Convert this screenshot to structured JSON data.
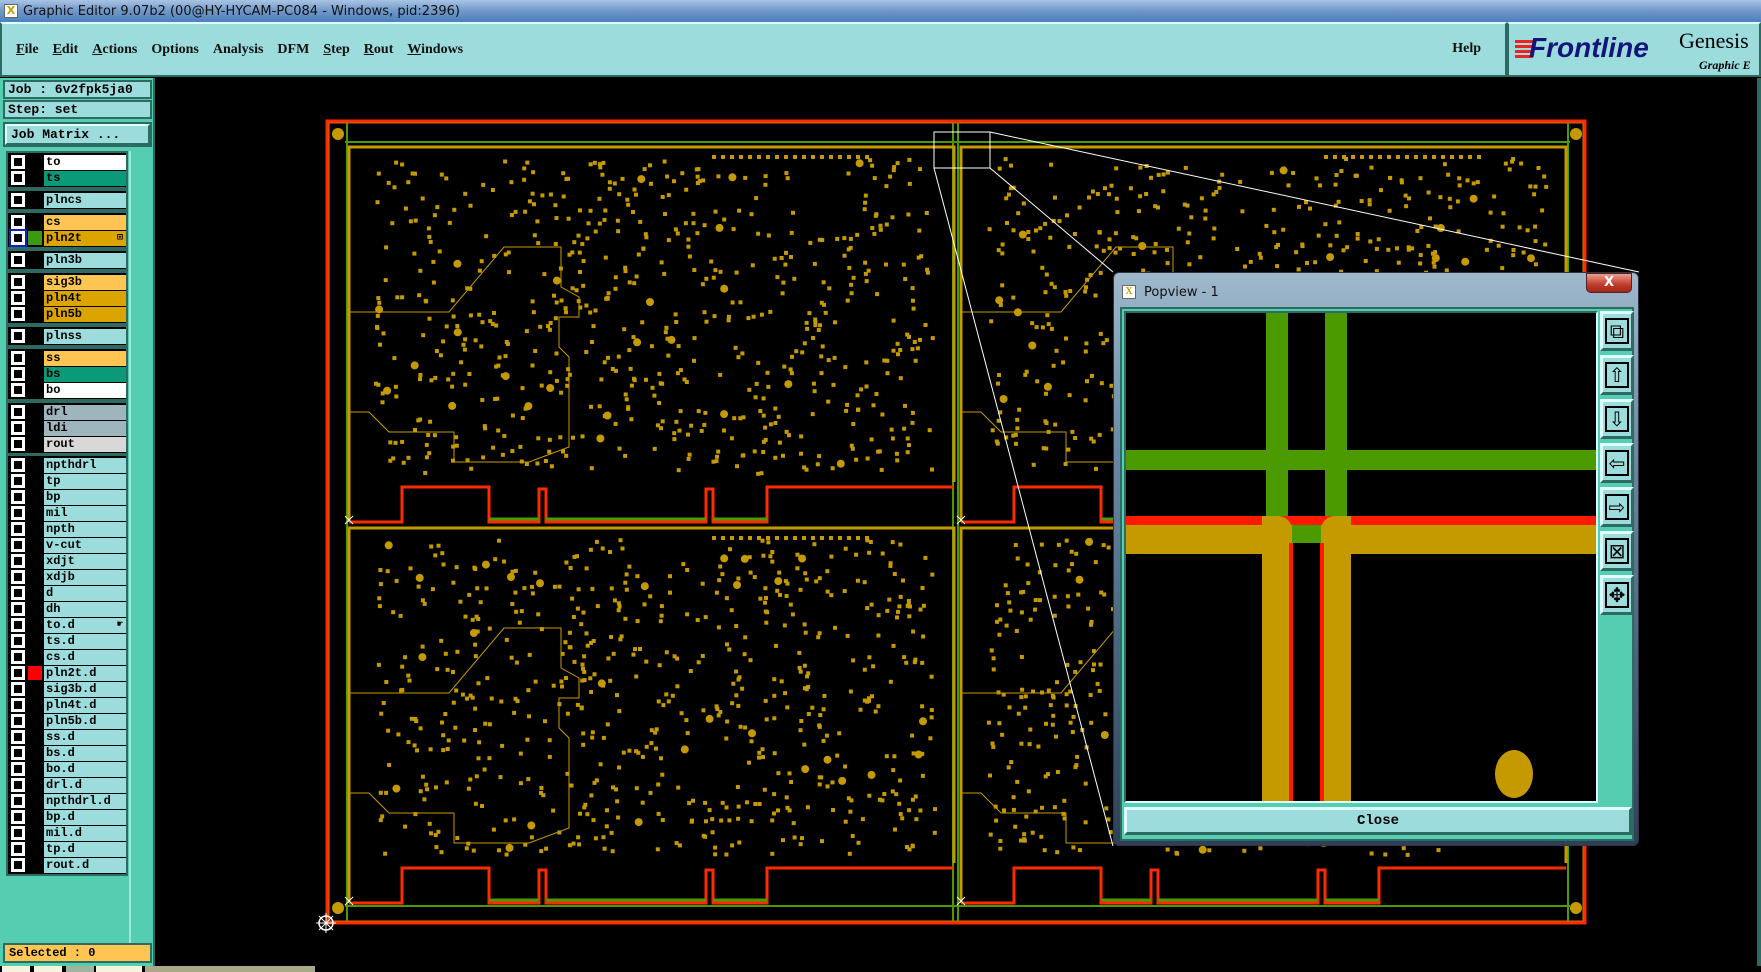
{
  "window": {
    "title": "Graphic Editor 9.07b2 (00@HY-HYCAM-PC084 - Windows, pid:2396)"
  },
  "menu": {
    "items": [
      "File",
      "Edit",
      "Actions",
      "Options",
      "Analysis",
      "DFM",
      "Step",
      "Rout",
      "Windows"
    ],
    "help": "Help"
  },
  "logo": {
    "brand": "Frontline",
    "product": "Genesis",
    "subtitle": "Graphic E"
  },
  "job": {
    "job_label": "Job : 6v2fpk5ja0",
    "step_label": "Step: set",
    "job_matrix_button": "Job Matrix ..."
  },
  "layers": {
    "groups": [
      [
        {
          "name": "to",
          "color": "#ffffff"
        },
        {
          "name": "ts",
          "color": "#0a9a78"
        }
      ],
      [
        {
          "name": "plncs",
          "color": "#9ddcdc"
        }
      ],
      [
        {
          "name": "cs",
          "color": "#ffc552"
        },
        {
          "name": "pln2t",
          "color": "#dca400",
          "swatch": "#3c9a10",
          "active": true,
          "marker": "⊞"
        }
      ],
      [
        {
          "name": "pln3b",
          "color": "#9ddcdc"
        }
      ],
      [
        {
          "name": "sig3b",
          "color": "#ffc552"
        },
        {
          "name": "pln4t",
          "color": "#dca400"
        },
        {
          "name": "pln5b",
          "color": "#dca400"
        }
      ],
      [
        {
          "name": "plnss",
          "color": "#9ddcdc"
        }
      ],
      [
        {
          "name": "ss",
          "color": "#ffc552"
        },
        {
          "name": "bs",
          "color": "#0a9a78"
        },
        {
          "name": "bo",
          "color": "#ffffff"
        }
      ],
      [
        {
          "name": "drl",
          "color": "#9fb5bd"
        },
        {
          "name": "ldi",
          "color": "#9fb5bd"
        },
        {
          "name": "rout",
          "color": "#d8d8d8"
        }
      ],
      [
        {
          "name": "npthdrl",
          "color": "#9ddcdc"
        },
        {
          "name": "tp",
          "color": "#9ddcdc"
        },
        {
          "name": "bp",
          "color": "#9ddcdc"
        },
        {
          "name": "mil",
          "color": "#9ddcdc"
        },
        {
          "name": "npth",
          "color": "#9ddcdc"
        },
        {
          "name": "v-cut",
          "color": "#9ddcdc"
        },
        {
          "name": "xdjt",
          "color": "#9ddcdc"
        },
        {
          "name": "xdjb",
          "color": "#9ddcdc"
        },
        {
          "name": "d",
          "color": "#9ddcdc"
        },
        {
          "name": "dh",
          "color": "#9ddcdc"
        },
        {
          "name": "to.d",
          "color": "#9ddcdc",
          "marker": "☛"
        },
        {
          "name": "ts.d",
          "color": "#9ddcdc"
        },
        {
          "name": "cs.d",
          "color": "#9ddcdc"
        },
        {
          "name": "pln2t.d",
          "color": "#9ddcdc",
          "swatch": "#ff0000"
        },
        {
          "name": "sig3b.d",
          "color": "#9ddcdc"
        },
        {
          "name": "pln4t.d",
          "color": "#9ddcdc"
        },
        {
          "name": "pln5b.d",
          "color": "#9ddcdc"
        },
        {
          "name": "ss.d",
          "color": "#9ddcdc"
        },
        {
          "name": "bs.d",
          "color": "#9ddcdc"
        },
        {
          "name": "bo.d",
          "color": "#9ddcdc"
        },
        {
          "name": "drl.d",
          "color": "#9ddcdc"
        },
        {
          "name": "npthdrl.d",
          "color": "#9ddcdc"
        },
        {
          "name": "bp.d",
          "color": "#9ddcdc"
        },
        {
          "name": "mil.d",
          "color": "#9ddcdc"
        },
        {
          "name": "tp.d",
          "color": "#9ddcdc"
        },
        {
          "name": "rout.d",
          "color": "#9ddcdc"
        }
      ]
    ]
  },
  "status": {
    "selected": "Selected : 0"
  },
  "popview": {
    "title": "Popview - 1",
    "close_x": "X",
    "close_button": "Close",
    "tools": [
      "zoom-home-icon",
      "pan-up-icon",
      "pan-down-icon",
      "pan-left-icon",
      "pan-right-icon",
      "zoom-in-icon",
      "zoom-out-icon"
    ]
  },
  "colors": {
    "panel": "#55cdb0",
    "menu": "#9ddcdc",
    "copper": "#c49a00",
    "outline": "#ff2a00",
    "green": "#4a9a00"
  }
}
